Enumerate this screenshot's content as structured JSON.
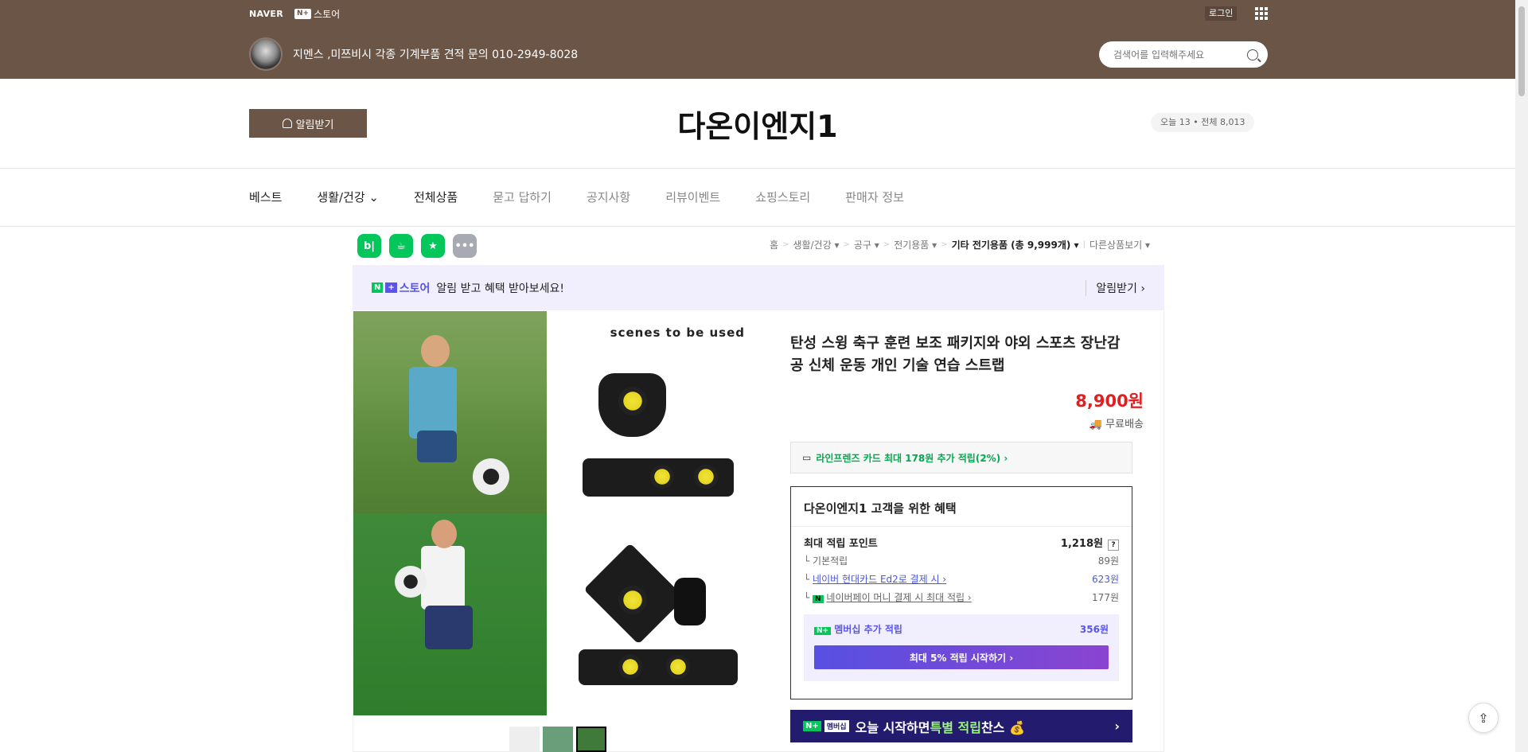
{
  "gnb": {
    "naver": "NAVER",
    "store_badge": "N+",
    "store_label": "스토어",
    "login": "로그인"
  },
  "store": {
    "info": "지멘스 ,미쯔비시 각종 기계부품 견적 문의 010-2949-8028",
    "name": "다온이엔지1",
    "search_placeholder": "검색어를 입력해주세요",
    "alarm_label": "알림받기",
    "visit": "오늘 13 • 전체 8,013"
  },
  "menu": [
    {
      "label": "베스트"
    },
    {
      "label": "생활/건강 ⌄"
    },
    {
      "label": "전체상품"
    },
    {
      "label": "묻고 답하기"
    },
    {
      "label": "공지사항"
    },
    {
      "label": "리뷰이벤트"
    },
    {
      "label": "쇼핑스토리"
    },
    {
      "label": "판매자 정보"
    }
  ],
  "quick_icons": [
    {
      "label": "b|",
      "color": "#03c75a"
    },
    {
      "label": "☕",
      "color": "#03c75a"
    },
    {
      "label": "★",
      "color": "#03c75a"
    },
    {
      "label": "•••",
      "color": "#a7a9b3"
    }
  ],
  "breadcrumb": [
    "홈",
    "생활/건강 ▾",
    "공구 ▾",
    "전기용품 ▾",
    "기타 전기용품 (총 9,999개) ▾",
    "다른상품보기 ▾"
  ],
  "promo": {
    "text": "알림 받고 혜택 받아보세요!",
    "action": "알림받기 ›",
    "logo_text": "스토어"
  },
  "product": {
    "image_caption": "scenes to be used",
    "title": "탄성 스윙 축구 훈련 보조 패키지와 야외 스포츠 장난감 공 신체 운동 개인 기술 연습 스트랩",
    "price": "8,900원",
    "shipping": "무료배송",
    "card_benefit": "라인프렌즈 카드 최대 178원 추가 적립(2%) ›"
  },
  "benefit": {
    "title": "다온이엔지1 고객을 위한 혜택",
    "max_label": "최대 적립 포인트",
    "max_value": "1,218원",
    "base_label": "기본적립",
    "base_value": "89원",
    "card_label": "네이버 현대카드 Ed2로 결제 시 ›",
    "card_value": "623원",
    "pay_label": "네이버페이 머니 결제 시 최대 적립 ›",
    "pay_value": "177원",
    "member_label": "멤버십 추가 적립",
    "member_value": "356원",
    "member_button": "최대 5% 적립 시작하기 ›"
  },
  "banner": {
    "pre": "오늘 시작하면 ",
    "hl": "특별 적립",
    "post": " 찬스 💰",
    "badge": "멤버십"
  }
}
